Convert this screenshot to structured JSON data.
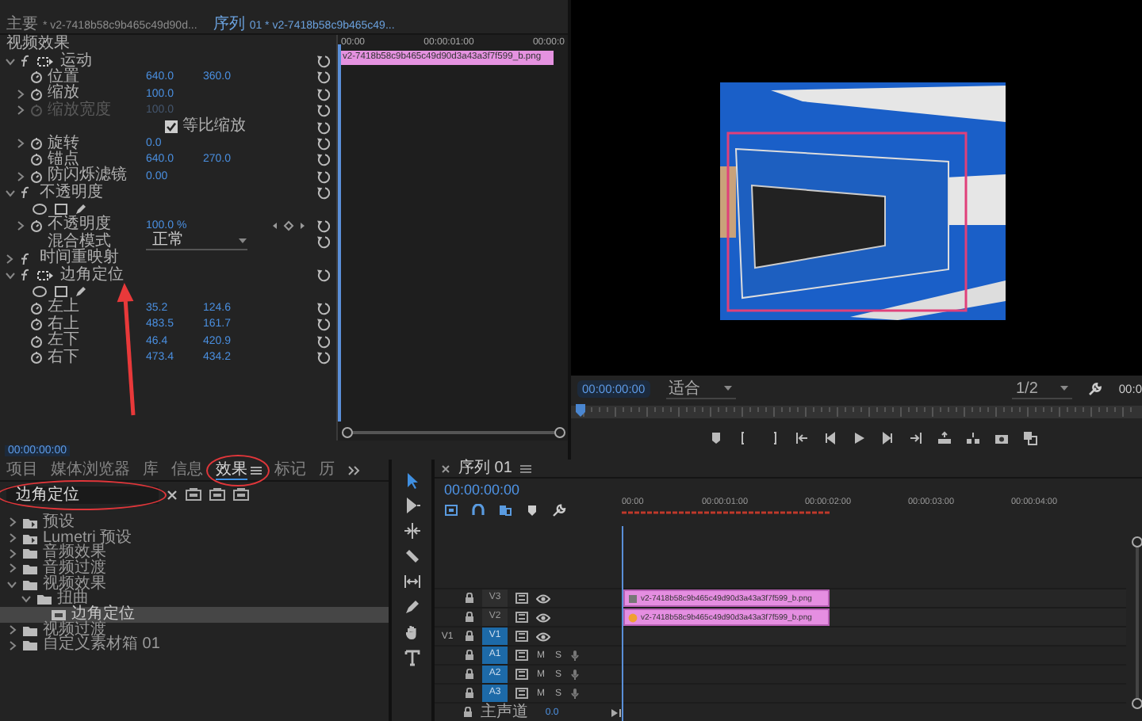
{
  "effect_controls": {
    "tabs": [
      {
        "name": "主要",
        "source": "* v2-7418b58c9b465c49d90d...",
        "selected": false
      },
      {
        "name": "序列",
        "source": "01 * v2-7418b58c9b465c49...",
        "selected": true
      }
    ],
    "rows": [
      {
        "kind": "section",
        "label": "视频效果"
      },
      {
        "kind": "effect",
        "label": "运动",
        "expanded": true,
        "transform_icon": true
      },
      {
        "kind": "param",
        "label": "位置",
        "values": [
          "640.0",
          "360.0"
        ],
        "expandable": false,
        "disabled": false,
        "keyframes": false
      },
      {
        "kind": "param",
        "label": "缩放",
        "values": [
          "100.0"
        ],
        "expandable": true,
        "disabled": false,
        "keyframes": false
      },
      {
        "kind": "param",
        "label": "缩放宽度",
        "values": [
          "100.0"
        ],
        "expandable": true,
        "disabled": true,
        "keyframes": false
      },
      {
        "kind": "checkbox",
        "label": "等比缩放",
        "checked": true
      },
      {
        "kind": "param",
        "label": "旋转",
        "values": [
          "0.0"
        ],
        "expandable": true,
        "disabled": false,
        "keyframes": false
      },
      {
        "kind": "param",
        "label": "锚点",
        "values": [
          "640.0",
          "270.0"
        ],
        "expandable": false,
        "disabled": false,
        "keyframes": false
      },
      {
        "kind": "param",
        "label": "防闪烁滤镜",
        "values": [
          "0.00"
        ],
        "expandable": true,
        "disabled": false,
        "keyframes": false
      },
      {
        "kind": "effect",
        "label": "不透明度",
        "expanded": true,
        "transform_icon": false
      },
      {
        "kind": "masks"
      },
      {
        "kind": "param",
        "label": "不透明度",
        "values": [
          "100.0 %"
        ],
        "expandable": true,
        "disabled": false,
        "keyframes": true
      },
      {
        "kind": "select",
        "label": "混合模式",
        "value": "正常"
      },
      {
        "kind": "effect",
        "label": "时间重映射",
        "expanded": false,
        "transform_icon": false
      },
      {
        "kind": "effect",
        "label": "边角定位",
        "expanded": true,
        "transform_icon": true
      },
      {
        "kind": "masks"
      },
      {
        "kind": "param",
        "label": "左上",
        "values": [
          "35.2",
          "124.6"
        ],
        "expandable": false,
        "disabled": false,
        "keyframes": false
      },
      {
        "kind": "param",
        "label": "右上",
        "values": [
          "483.5",
          "161.7"
        ],
        "expandable": false,
        "disabled": false,
        "keyframes": false
      },
      {
        "kind": "param",
        "label": "左下",
        "values": [
          "46.4",
          "420.9"
        ],
        "expandable": false,
        "disabled": false,
        "keyframes": false
      },
      {
        "kind": "param",
        "label": "右下",
        "values": [
          "473.4",
          "434.2"
        ],
        "expandable": false,
        "disabled": false,
        "keyframes": false
      }
    ],
    "ruler": [
      "00:00",
      "00:00:01:00",
      "00:00:0"
    ],
    "clip": "v2-7418b58c9b465c49d90d3a43a3f7f599_b.png",
    "timecode": "00:00:00:00"
  },
  "program_monitor": {
    "timecode": "00:00:00:00",
    "zoom": "适合",
    "resolution": "1/2",
    "duration": "00:0"
  },
  "effects_panel": {
    "tabs": [
      {
        "label": "项目",
        "selected": false
      },
      {
        "label": "媒体浏览器",
        "selected": false
      },
      {
        "label": "库",
        "selected": false
      },
      {
        "label": "信息",
        "selected": false
      },
      {
        "label": "效果",
        "selected": true
      },
      {
        "label": "标记",
        "selected": false
      },
      {
        "label": "历",
        "selected": false
      }
    ],
    "search": {
      "value": "边角定位"
    },
    "tree": [
      {
        "label": "预设",
        "kind": "preset",
        "expanded": false,
        "selected": false
      },
      {
        "label": "Lumetri 预设",
        "kind": "preset",
        "expanded": false,
        "selected": false
      },
      {
        "label": "音频效果",
        "kind": "folder",
        "expanded": false,
        "selected": false
      },
      {
        "label": "音频过渡",
        "kind": "folder",
        "expanded": false,
        "selected": false
      },
      {
        "label": "视频效果",
        "kind": "folder",
        "expanded": true,
        "selected": false,
        "children": [
          {
            "label": "扭曲",
            "kind": "folder",
            "expanded": true,
            "selected": false,
            "children": [
              {
                "label": "边角定位",
                "kind": "effect",
                "selected": true
              }
            ]
          }
        ]
      },
      {
        "label": "视频过渡",
        "kind": "folder",
        "expanded": false,
        "selected": false
      },
      {
        "label": "自定义素材箱 01",
        "kind": "folder",
        "expanded": false,
        "selected": false
      }
    ]
  },
  "tools": [
    {
      "kind": "selection",
      "selected": true
    },
    {
      "kind": "track-select",
      "selected": false
    },
    {
      "kind": "ripple",
      "selected": false
    },
    {
      "kind": "razor",
      "selected": false
    },
    {
      "kind": "slip",
      "selected": false
    },
    {
      "kind": "pen",
      "selected": false
    },
    {
      "kind": "hand",
      "selected": false
    },
    {
      "kind": "type",
      "selected": false
    }
  ],
  "timeline": {
    "title": "序列 01",
    "timecode": "00:00:00:00",
    "ruler": [
      "00:00",
      "00:00:01:00",
      "00:00:02:00",
      "00:00:03:00",
      "00:00:04:00"
    ],
    "tracks": [
      {
        "name": "V3",
        "kind": "video",
        "targeted": false,
        "clips": [
          {
            "label": "v2-7418b58c9b465c49d90d3a43a3f7f599_b.png",
            "fx_applied": false
          }
        ]
      },
      {
        "name": "V2",
        "kind": "video",
        "targeted": false,
        "clips": [
          {
            "label": "v2-7418b58c9b465c49d90d3a43a3f7f599_b.png",
            "fx_applied": true
          }
        ]
      },
      {
        "name": "V1",
        "kind": "video",
        "targeted": true,
        "source": "V1"
      },
      {
        "name": "A1",
        "kind": "audio",
        "targeted": true,
        "mute": "M",
        "solo": "S"
      },
      {
        "name": "A2",
        "kind": "audio",
        "targeted": true,
        "mute": "M",
        "solo": "S"
      },
      {
        "name": "A3",
        "kind": "audio",
        "targeted": true,
        "mute": "M",
        "solo": "S"
      }
    ],
    "master": {
      "label": "主声道",
      "value": "0.0"
    }
  }
}
